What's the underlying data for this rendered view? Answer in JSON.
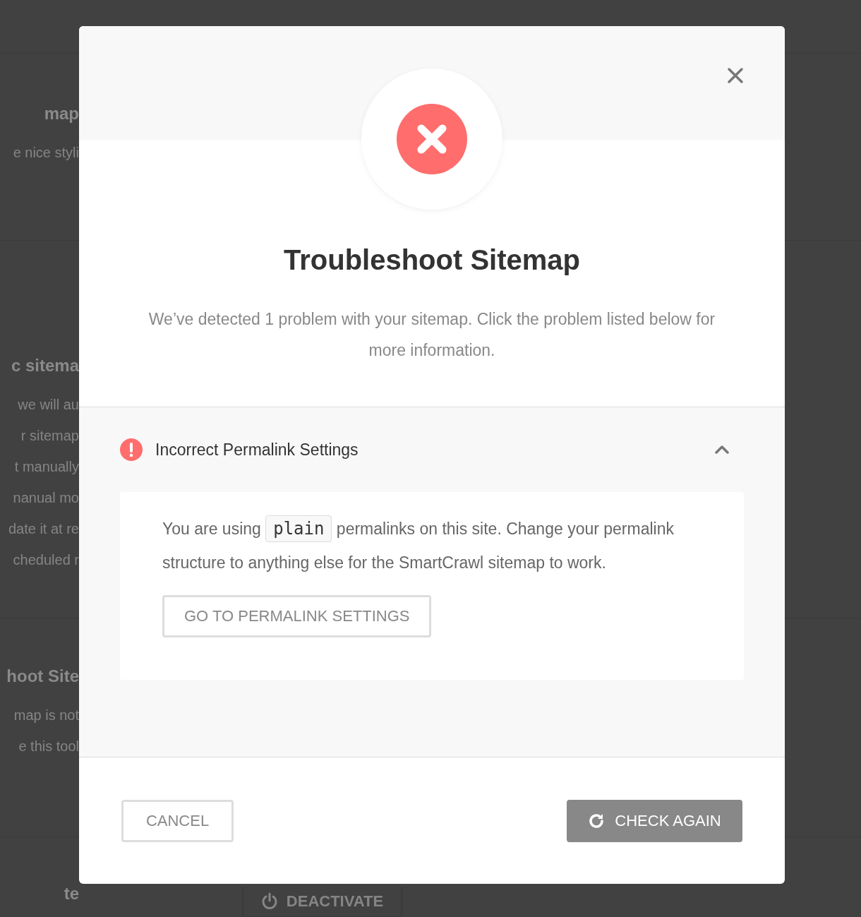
{
  "background": {
    "sections": [
      {
        "title": "map",
        "lines": [
          "e nice styli"
        ]
      },
      {
        "title": "c sitema",
        "lines": [
          "we will au",
          "r sitemap",
          "t manually",
          "nanual mo",
          "date it at re",
          "cheduled r"
        ]
      },
      {
        "title": "hoot Site",
        "lines": [
          "map is not",
          "e this tool"
        ]
      },
      {
        "title": "te",
        "button": "DEACTIVATE"
      }
    ]
  },
  "modal": {
    "title": "Troubleshoot Sitemap",
    "description": "We’ve detected 1 problem with your sitemap. Click the problem listed below for more information.",
    "problem": {
      "title": "Incorrect Permalink Settings",
      "expanded": true,
      "text_before": "You are using",
      "code": "plain",
      "text_after": "permalinks on this site. Change your permalink structure to anything else for the SmartCrawl sitemap to work.",
      "button": "GO TO PERMALINK SETTINGS"
    },
    "footer": {
      "cancel": "CANCEL",
      "check_again": "CHECK AGAIN"
    }
  }
}
